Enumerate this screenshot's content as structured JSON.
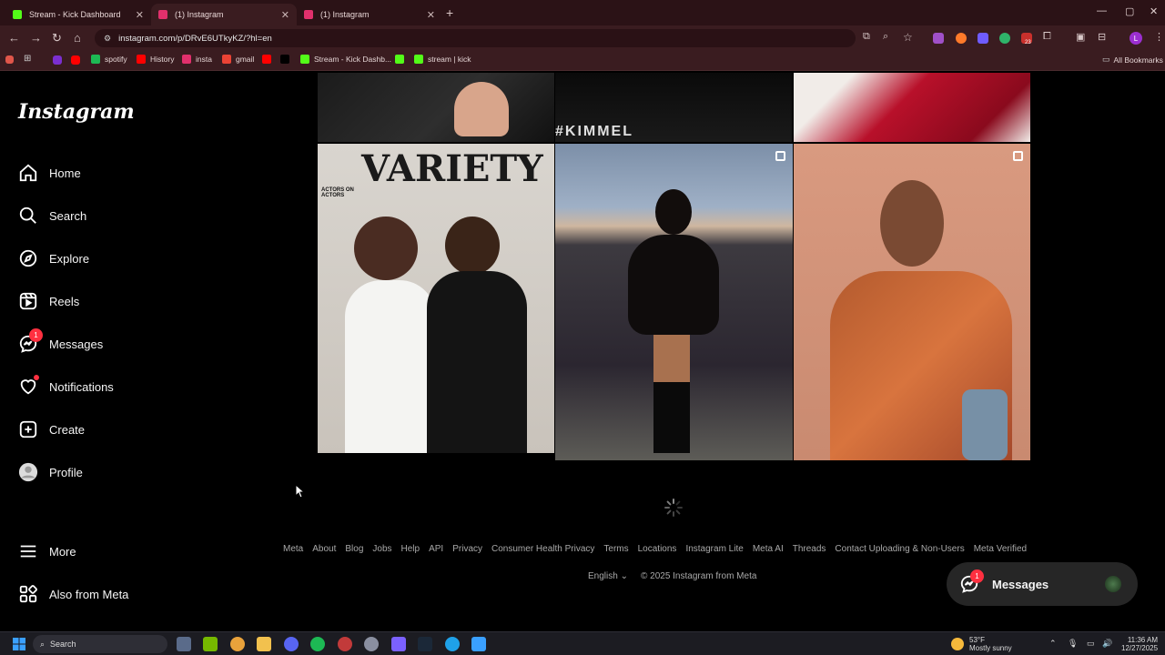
{
  "browser": {
    "tabs": [
      {
        "title": "Stream - Kick Dashboard",
        "favicon": "kick-icon",
        "color": "#53fc18"
      },
      {
        "title": "(1) Instagram",
        "favicon": "instagram-icon",
        "color": "#e1306c"
      },
      {
        "title": "(1) Instagram",
        "favicon": "instagram-icon",
        "color": "#e1306c"
      }
    ],
    "url": "instagram.com/p/DRvE6UTkyKZ/?hl=en",
    "bookmarks": [
      {
        "label": "spotify",
        "color": "#1db954"
      },
      {
        "label": "History",
        "color": "#ff0000"
      },
      {
        "label": "insta",
        "color": "#e1306c"
      },
      {
        "label": "gmail",
        "color": "#ea4335"
      },
      {
        "label": "",
        "color": "#ff0000"
      },
      {
        "label": "",
        "color": "#000000"
      },
      {
        "label": "Stream - Kick Dashb...",
        "color": "#53fc18"
      },
      {
        "label": "",
        "color": "#53fc18"
      },
      {
        "label": "stream | kick",
        "color": "#53fc18"
      }
    ],
    "all_bookmarks": "All Bookmarks",
    "ext_badge": "23",
    "profile_initial": "L"
  },
  "sidebar": {
    "logo": "Instagram",
    "items": [
      {
        "label": "Home",
        "icon": "home-icon"
      },
      {
        "label": "Search",
        "icon": "search-icon"
      },
      {
        "label": "Explore",
        "icon": "compass-icon"
      },
      {
        "label": "Reels",
        "icon": "reels-icon"
      },
      {
        "label": "Messages",
        "icon": "messenger-icon",
        "badge": "1"
      },
      {
        "label": "Notifications",
        "icon": "heart-icon"
      },
      {
        "label": "Create",
        "icon": "plus-square-icon"
      },
      {
        "label": "Profile",
        "icon": "avatar-icon"
      }
    ],
    "more": "More",
    "also_from_meta": "Also from Meta"
  },
  "grid": {
    "top_text": "#KIMMEL",
    "cover_text": "VARIETY",
    "cover_sub": "ACTORS ON ACTORS"
  },
  "footer": {
    "links": [
      "Meta",
      "About",
      "Blog",
      "Jobs",
      "Help",
      "API",
      "Privacy",
      "Consumer Health Privacy",
      "Terms",
      "Locations",
      "Instagram Lite",
      "Meta AI",
      "Threads",
      "Contact Uploading & Non-Users",
      "Meta Verified"
    ],
    "language": "English",
    "copyright": "© 2025 Instagram from Meta"
  },
  "messages_pill": {
    "label": "Messages",
    "badge": "1"
  },
  "taskbar": {
    "search": "Search",
    "weather_temp": "53°F",
    "weather_desc": "Mostly sunny",
    "time": "11:36 AM",
    "date": "12/27/2025"
  },
  "colors": {
    "accent_red": "#ff3040",
    "chrome_bg": "#3a1c20",
    "kick_green": "#53fc18"
  }
}
